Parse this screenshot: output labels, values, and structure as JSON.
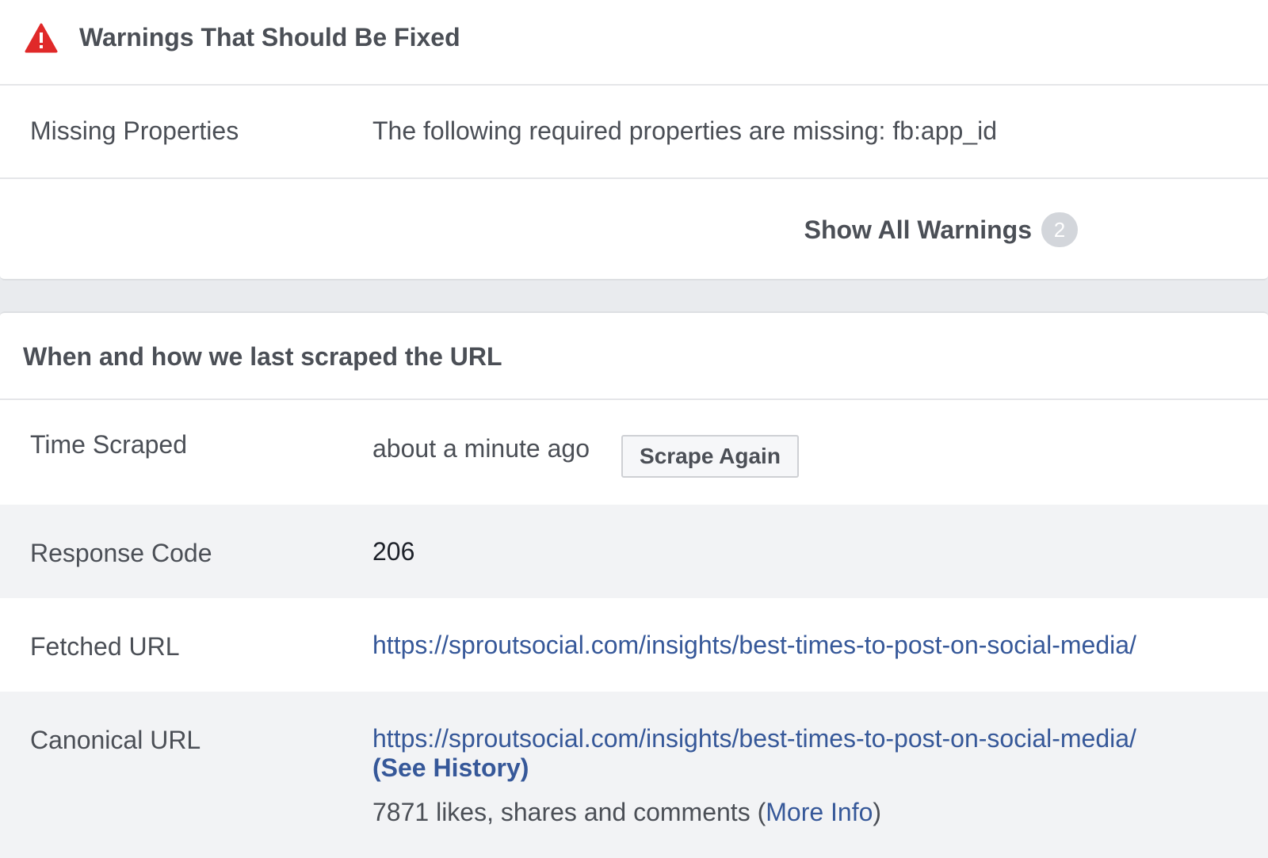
{
  "warnings": {
    "title": "Warnings That Should Be Fixed",
    "icon": "warning-triangle-icon",
    "icon_color": "#e02929",
    "rows": [
      {
        "label": "Missing Properties",
        "value": "The following required properties are missing: fb:app_id"
      }
    ],
    "show_all_label": "Show All Warnings",
    "show_all_count": "2"
  },
  "scrape": {
    "title": "When and how we last scraped the URL",
    "time_scraped": {
      "label": "Time Scraped",
      "value": "about a minute ago",
      "button": "Scrape Again"
    },
    "response_code": {
      "label": "Response Code",
      "value": "206"
    },
    "fetched_url": {
      "label": "Fetched URL",
      "value": "https://sproutsocial.com/insights/best-times-to-post-on-social-media/"
    },
    "canonical_url": {
      "label": "Canonical URL",
      "value": "https://sproutsocial.com/insights/best-times-to-post-on-social-media/",
      "see_history": "(See History)",
      "engagement_text": "7871 likes, shares and comments (",
      "more_info": "More Info",
      "engagement_close": ")"
    }
  },
  "colors": {
    "link": "#365899",
    "background": "#e9ebee",
    "alt_row": "#f2f3f5"
  }
}
